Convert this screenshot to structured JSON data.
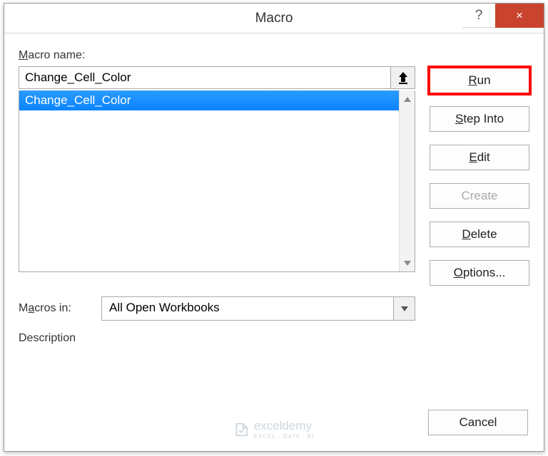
{
  "dialog": {
    "title": "Macro",
    "help_tooltip": "?",
    "close_tooltip": "×"
  },
  "labels": {
    "macro_name": "Macro name:",
    "macros_in": "Macros in:",
    "description": "Description"
  },
  "macro_name_input": {
    "value": "Change_Cell_Color"
  },
  "macro_list": {
    "items": [
      {
        "label": "Change_Cell_Color",
        "selected": true
      }
    ]
  },
  "macros_in": {
    "selected": "All Open Workbooks"
  },
  "buttons": {
    "run": "Run",
    "step_into": "Step Into",
    "edit": "Edit",
    "create": "Create",
    "delete": "Delete",
    "options": "Options...",
    "cancel": "Cancel"
  },
  "watermark": {
    "brand": "exceldemy",
    "tagline": "EXCEL · DATA · BI"
  }
}
